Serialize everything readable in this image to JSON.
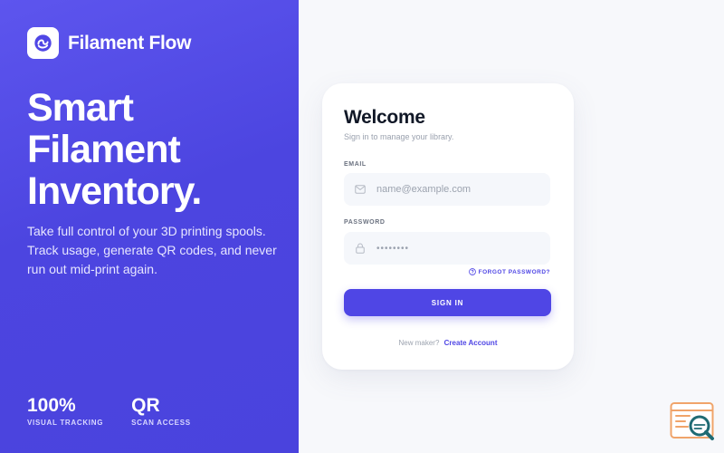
{
  "brand": {
    "name": "Filament Flow",
    "logo_icon": "filament-spool-icon"
  },
  "hero": {
    "headline_lines": [
      "Smart",
      "Filament",
      "Inventory."
    ],
    "tagline": "Take full control of your 3D printing spools. Track usage, generate QR codes, and never run out mid-print again.",
    "stats": [
      {
        "value": "100%",
        "label": "VISUAL TRACKING"
      },
      {
        "value": "QR",
        "label": "SCAN ACCESS"
      }
    ]
  },
  "login": {
    "title": "Welcome",
    "subtitle": "Sign in to manage your library.",
    "email": {
      "label": "EMAIL",
      "placeholder": "name@example.com",
      "icon": "mail-icon"
    },
    "password": {
      "label": "PASSWORD",
      "value": "••••••••",
      "icon": "lock-icon"
    },
    "forgot_label": "FORGOT PASSWORD?",
    "submit_label": "SIGN IN",
    "footer_text": "New maker?",
    "footer_link": "Create Account"
  },
  "colors": {
    "accent": "#4f46e5",
    "hero_gradient_start": "#5d55ee",
    "hero_gradient_end": "#4a43dd",
    "page_background": "#f7f8fb"
  }
}
